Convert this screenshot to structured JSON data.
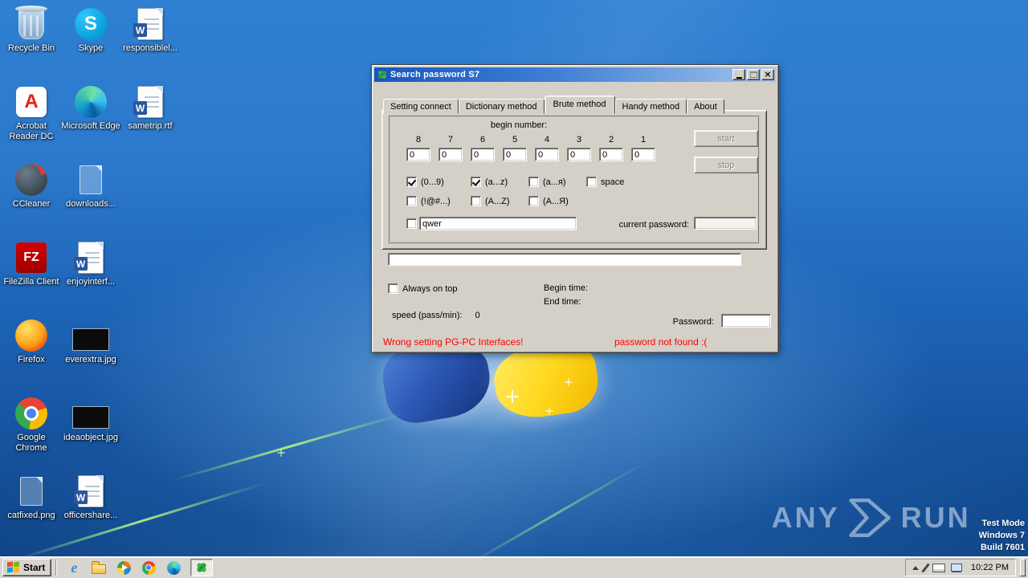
{
  "colors": {
    "status_error": "#ff0000",
    "titlebar_gradient_left": "#1557be",
    "titlebar_gradient_right": "#a4c4ec",
    "desktop_blue": "#2c79cc",
    "classic_gray": "#d4d0c8"
  },
  "desktop": {
    "icons": [
      {
        "label": "Recycle Bin",
        "kind": "recycle-bin",
        "col": 0,
        "row": 0
      },
      {
        "label": "Skype",
        "kind": "skype",
        "col": 1,
        "row": 0
      },
      {
        "label": "responsiblel...",
        "kind": "word-doc",
        "col": 2,
        "row": 0
      },
      {
        "label": "Acrobat Reader DC",
        "kind": "acrobat",
        "col": 0,
        "row": 1
      },
      {
        "label": "Microsoft Edge",
        "kind": "edge",
        "col": 1,
        "row": 1
      },
      {
        "label": "sametrip.rtf",
        "kind": "word-doc",
        "col": 2,
        "row": 1
      },
      {
        "label": "CCleaner",
        "kind": "ccleaner",
        "col": 0,
        "row": 2
      },
      {
        "label": "downloads...",
        "kind": "ghost-file",
        "col": 1,
        "row": 2
      },
      {
        "label": "FileZilla Client",
        "kind": "filezilla",
        "col": 0,
        "row": 3
      },
      {
        "label": "enjoyinterf...",
        "kind": "word-doc",
        "col": 1,
        "row": 3
      },
      {
        "label": "Firefox",
        "kind": "firefox",
        "col": 0,
        "row": 4
      },
      {
        "label": "everextra.jpg",
        "kind": "jpg-thumb",
        "col": 1,
        "row": 4
      },
      {
        "label": "Google Chrome",
        "kind": "chrome",
        "col": 0,
        "row": 5
      },
      {
        "label": "ideaobject.jpg",
        "kind": "jpg-thumb",
        "col": 1,
        "row": 5
      },
      {
        "label": "catfixed.png",
        "kind": "ghost-file",
        "col": 0,
        "row": 6
      },
      {
        "label": "officershare...",
        "kind": "word-doc",
        "col": 1,
        "row": 6
      }
    ]
  },
  "window": {
    "title": "Search password S7",
    "tabs": [
      "Setting connect",
      "Dictionary method",
      "Brute method",
      "Handy method",
      "About"
    ],
    "active_tab": "Brute method",
    "brute": {
      "begin_number_label": "begin number:",
      "digits": [
        {
          "label": "8",
          "value": "0"
        },
        {
          "label": "7",
          "value": "0"
        },
        {
          "label": "6",
          "value": "0"
        },
        {
          "label": "5",
          "value": "0"
        },
        {
          "label": "4",
          "value": "0"
        },
        {
          "label": "3",
          "value": "0"
        },
        {
          "label": "2",
          "value": "0"
        },
        {
          "label": "1",
          "value": "0"
        }
      ],
      "start_button": "start",
      "stop_button": "stop",
      "charset_row1": [
        {
          "label": "(0...9)",
          "checked": true
        },
        {
          "label": "(a...z)",
          "checked": true
        },
        {
          "label": "(a...я)",
          "checked": false
        },
        {
          "label": "space",
          "checked": false
        }
      ],
      "charset_row2": [
        {
          "label": "(!@#...)",
          "checked": false
        },
        {
          "label": "(A...Z)",
          "checked": false
        },
        {
          "label": "(A...Я)",
          "checked": false
        }
      ],
      "custom_charset": {
        "checked": false,
        "value": "qwer"
      },
      "current_password_label": "current password:",
      "current_password_value": ""
    },
    "always_on_top": {
      "label": "Always on top",
      "checked": false
    },
    "begin_time_label": "Begin time:",
    "end_time_label": "End time:",
    "speed_label": "speed (pass/min):",
    "speed_value": "0",
    "password_label": "Password:",
    "password_value": "",
    "status_left": "Wrong setting PG-PC Interfaces!",
    "status_right": "password not found :("
  },
  "taskbar": {
    "start_label": "Start",
    "quick_launch": [
      "internet-explorer",
      "windows-explorer",
      "media-player",
      "google-chrome",
      "microsoft-edge"
    ],
    "running_app": "search-password-s7",
    "tray_icons": [
      "hidden-icons-chevron",
      "pen-input",
      "touch-keyboard",
      "network"
    ],
    "clock": "10:22 PM"
  },
  "watermark": {
    "brand_left": "ANY",
    "brand_right": "RUN",
    "info_line1": "Test Mode",
    "info_line2": "Windows 7",
    "info_line3": "Build 7601"
  }
}
